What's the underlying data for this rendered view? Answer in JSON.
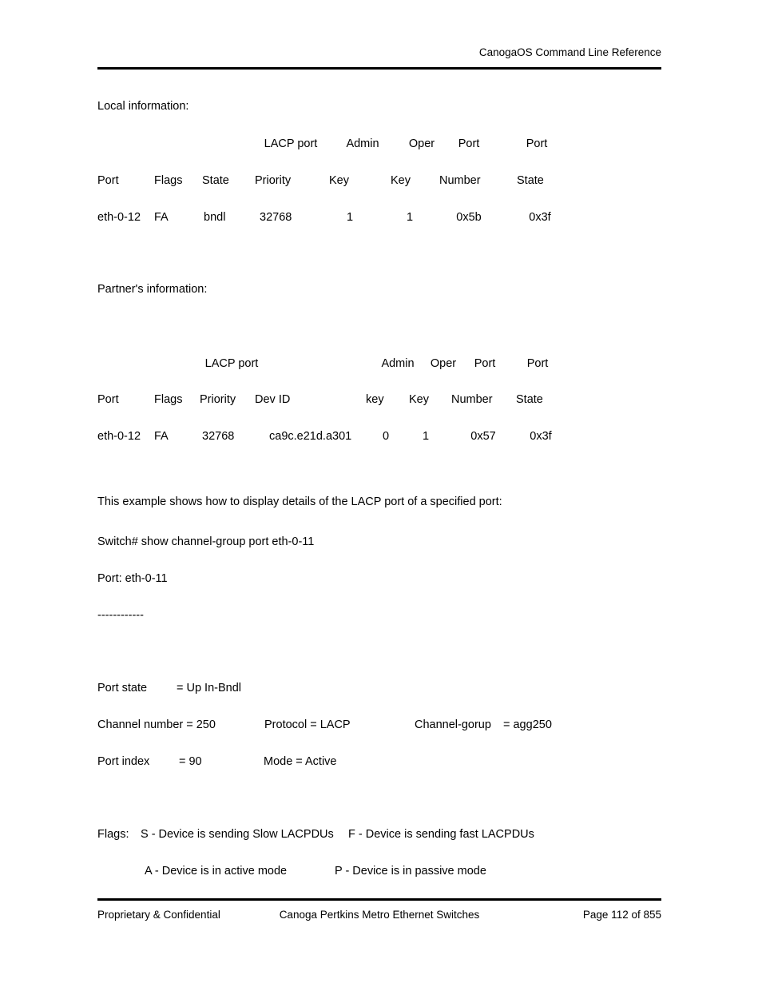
{
  "document": {
    "header_title": "CanogaOS Command Line Reference",
    "footer": {
      "left": "Proprietary & Confidential",
      "center": "Canoga Pertkins Metro Ethernet Switches",
      "right": "Page 112 of 855"
    }
  },
  "sections": {
    "local_label": "Local information:",
    "partner_label": "Partner's information:",
    "example_intro": "This example shows how to display details of the LACP port of a specified port:",
    "command_line": "Switch# show channel-group port eth-0-11",
    "port_line": "Port: eth-0-11",
    "separator": "------------"
  },
  "local_table": {
    "header_top": {
      "lacp_port": "LACP port",
      "admin": "Admin",
      "oper": "Oper",
      "port1": "Port",
      "port2": "Port"
    },
    "header_bottom": {
      "port": "Port",
      "flags": "Flags",
      "state": "State",
      "priority": "Priority",
      "admin_key": "Key",
      "oper_key": "Key",
      "number": "Number",
      "port_state": "State"
    },
    "rows": [
      {
        "port": "eth-0-12",
        "flags": "FA",
        "state": "bndl",
        "priority": "32768",
        "admin_key": "1",
        "oper_key": "1",
        "number": "0x5b",
        "port_state": "0x3f"
      }
    ]
  },
  "partner_table": {
    "header_top": {
      "lacp_port": "LACP port",
      "admin": "Admin",
      "oper": "Oper",
      "port1": "Port",
      "port2": "Port"
    },
    "header_bottom": {
      "port": "Port",
      "flags": "Flags",
      "priority": "Priority",
      "dev_id": "Dev ID",
      "admin_key": "key",
      "oper_key": "Key",
      "number": "Number",
      "port_state": "State"
    },
    "rows": [
      {
        "port": "eth-0-12",
        "flags": "FA",
        "priority": "32768",
        "dev_id": "ca9c.e21d.a301",
        "admin_key": "0",
        "oper_key": "1",
        "number": "0x57",
        "port_state": "0x3f"
      }
    ]
  },
  "port_details": {
    "port_state_label": "Port state",
    "port_state_value": "= Up In-Bndl",
    "channel_number_label": "Channel number = 250",
    "protocol_label": "Protocol = LACP",
    "channel_group_label": "Channel-gorup",
    "channel_group_value": "= agg250",
    "port_index_label": "Port index",
    "port_index_value": "= 90",
    "mode_label": "Mode = Active"
  },
  "flags_legend": {
    "title": "Flags:",
    "slow": "S - Device is sending Slow LACPDUs",
    "fast": "F - Device is sending fast LACPDUs",
    "active": "A - Device is in active mode",
    "passive": "P - Device is in passive mode"
  }
}
